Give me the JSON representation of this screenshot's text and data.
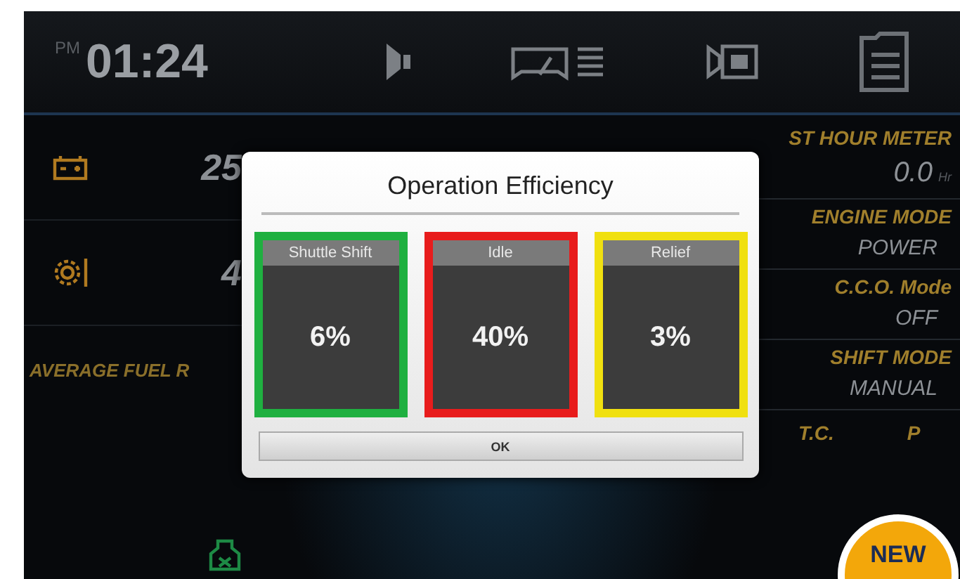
{
  "top_bar": {
    "period": "PM",
    "time": "01:24"
  },
  "left_panel": {
    "rows": [
      {
        "kind": "battery",
        "value": "25"
      },
      {
        "kind": "gear",
        "value": "4"
      }
    ],
    "fuel_label": "AVERAGE FUEL R"
  },
  "right_panel": [
    {
      "label": "ST HOUR METER",
      "value": "0.0",
      "unit": "Hr"
    },
    {
      "label": "ENGINE MODE",
      "value": "POWER"
    },
    {
      "label": "C.C.O. Mode",
      "value": "OFF"
    },
    {
      "label": "SHIFT MODE",
      "value": "MANUAL"
    },
    {
      "label": "T.C.",
      "value": "P"
    }
  ],
  "dialog": {
    "title": "Operation Efficiency",
    "cards": [
      {
        "label": "Shuttle Shift",
        "value": "6%",
        "color": "#1fb040"
      },
      {
        "label": "Idle",
        "value": "40%",
        "color": "#e81c1c"
      },
      {
        "label": "Relief",
        "value": "3%",
        "color": "#f0e010"
      }
    ],
    "button": "OK"
  },
  "badge": "NEW"
}
